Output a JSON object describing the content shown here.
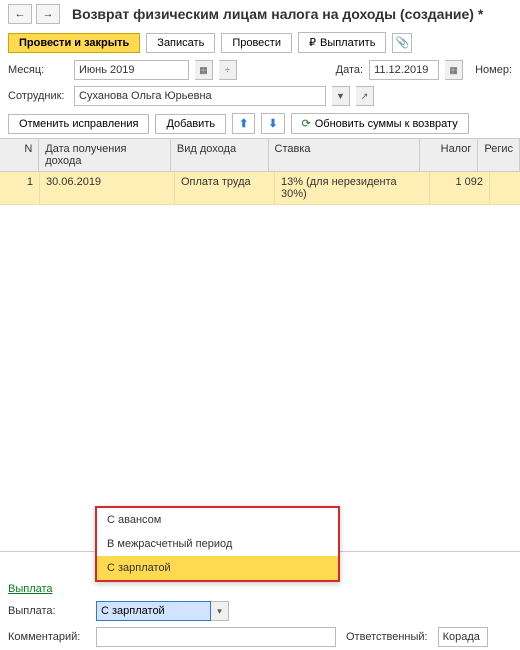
{
  "title": "Возврат физическим лицам налога на доходы (создание) *",
  "toolbar": {
    "provesti_zakryt": "Провести и закрыть",
    "zapisat": "Записать",
    "provesti": "Провести",
    "vyplatit": "Выплатить"
  },
  "form": {
    "mesyats_label": "Месяц:",
    "mesyats_value": "Июнь 2019",
    "data_label": "Дата:",
    "data_value": "11.12.2019",
    "nomer_label": "Номер:",
    "sotrudnik_label": "Сотрудник:",
    "sotrudnik_value": "Суханова Ольга Юрьевна"
  },
  "subbar": {
    "otmenit": "Отменить исправления",
    "dobavit": "Добавить",
    "obnovit": "Обновить суммы к возврату"
  },
  "table": {
    "headers": {
      "n": "N",
      "date": "Дата получения дохода",
      "type": "Вид дохода",
      "rate": "Ставка",
      "tax": "Налог",
      "regis": "Регис"
    },
    "rows": [
      {
        "n": "1",
        "date": "30.06.2019",
        "type": "Оплата труда",
        "rate": "13% (для нерезидента 30%)",
        "tax": "1 092"
      }
    ]
  },
  "dropdown": {
    "opt1": "С авансом",
    "opt2": "В межрасчетный период",
    "opt3": "С зарплатой"
  },
  "section": {
    "vyplata_link": "Выплата",
    "vyplata_label": "Выплата:",
    "vyplata_value": "С зарплатой"
  },
  "footer": {
    "komment_label": "Комментарий:",
    "otvet_label": "Ответственный:",
    "otvet_value": "Корада"
  }
}
